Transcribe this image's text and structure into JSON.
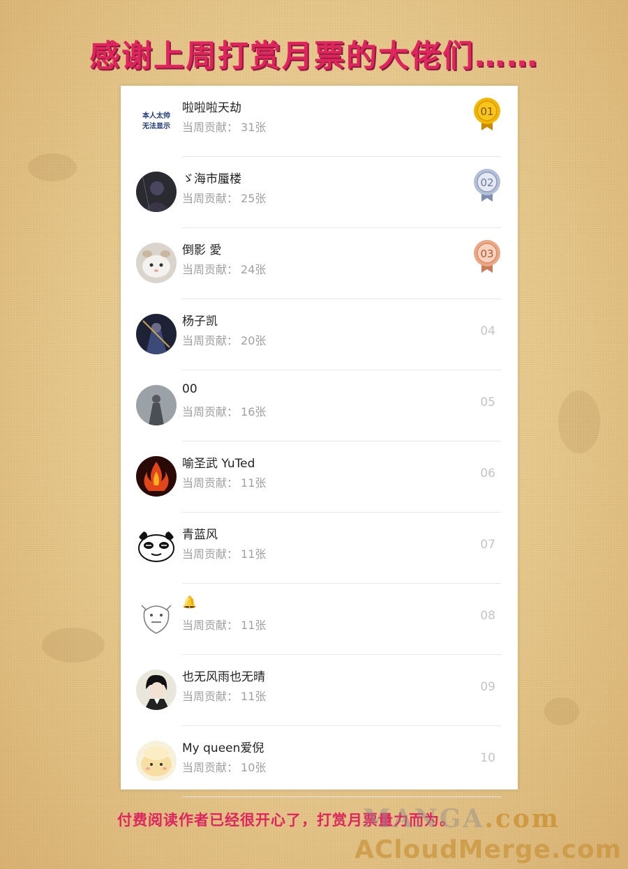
{
  "header": {
    "title": "感谢上周打赏月票的大佬们……"
  },
  "leaderboard": {
    "contrib_label": "当周贡献：",
    "entries": [
      {
        "name": "啦啦啦天劫",
        "votes": "31张",
        "rank": "01",
        "medal": "gold",
        "avatar_text": "本人太帅\n无法显示"
      },
      {
        "name": "ゞ海市蜃楼",
        "votes": "25张",
        "rank": "02",
        "medal": "silver"
      },
      {
        "name": "倒影 愛",
        "votes": "24张",
        "rank": "03",
        "medal": "bronze"
      },
      {
        "name": "杨子凯",
        "votes": "20张",
        "rank": "04"
      },
      {
        "name": "00",
        "votes": "16张",
        "rank": "05"
      },
      {
        "name": "喻圣武 YuTed",
        "votes": "11张",
        "rank": "06"
      },
      {
        "name": "青蓝风",
        "votes": "11张",
        "rank": "07"
      },
      {
        "name": "🔔",
        "votes": "11张",
        "rank": "08"
      },
      {
        "name": "也无风雨也无晴",
        "votes": "11张",
        "rank": "09"
      },
      {
        "name": "My queen爱倪",
        "votes": "10张",
        "rank": "10"
      }
    ]
  },
  "footer": {
    "text": "付费阅读作者已经很开心了，打赏月票量力而为。"
  },
  "watermark": {
    "line1_a": "MANGA",
    "line1_b": ".com",
    "line2": "ACloudMerge.com"
  },
  "colors": {
    "title": "#e0245e",
    "gold": "#f2b705",
    "silver": "#9aa7c7",
    "bronze": "#e49a76"
  }
}
